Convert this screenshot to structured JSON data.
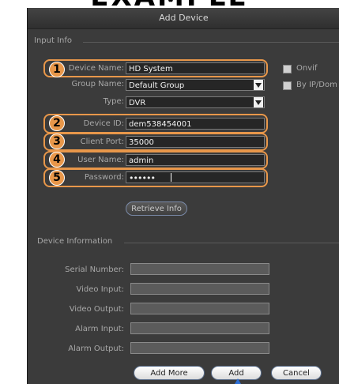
{
  "banner": {
    "text": "EXAMPLE"
  },
  "dialog": {
    "title": "Add Device"
  },
  "input_info": {
    "section_label": "Input Info",
    "device_name": {
      "label": "Device Name:",
      "value": "HD System"
    },
    "group_name": {
      "label": "Group Name:",
      "value": "Default Group"
    },
    "type": {
      "label": "Type:",
      "value": "DVR"
    },
    "device_id": {
      "label": "Device ID:",
      "value": "dem538454001"
    },
    "client_port": {
      "label": "Client Port:",
      "value": "35000"
    },
    "user_name": {
      "label": "User Name:",
      "value": "admin"
    },
    "password": {
      "label": "Password:",
      "value": "••••••"
    },
    "onvif": {
      "label": "Onvif"
    },
    "by_ip": {
      "label": "By IP/Dom"
    },
    "retrieve_label": "Retrieve Info"
  },
  "device_information": {
    "section_label": "Device Information",
    "fields": [
      {
        "label": "Serial Number:"
      },
      {
        "label": "Video Input:"
      },
      {
        "label": "Video Output:"
      },
      {
        "label": "Alarm Input:"
      },
      {
        "label": "Alarm Output:"
      }
    ]
  },
  "badges": [
    "1",
    "2",
    "3",
    "4",
    "5"
  ],
  "buttons": {
    "add_more": "Add More",
    "add": "Add",
    "cancel": "Cancel"
  },
  "colors": {
    "highlight": "#e8974a",
    "dialog_bg": "#3b3b3b",
    "pointer": "#2d6fd6"
  }
}
